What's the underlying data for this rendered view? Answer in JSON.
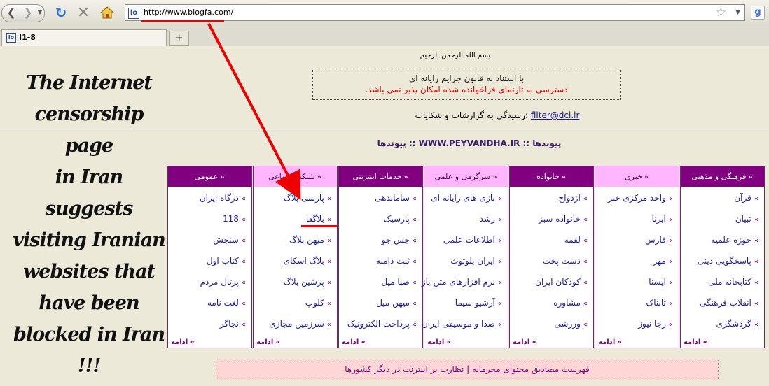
{
  "browser": {
    "url": "http://www.blogfa.com/",
    "tab_title": "I1-8",
    "favicon_letters": "lo",
    "new_tab_symbol": "+",
    "google_letter": "g"
  },
  "page": {
    "bismillah": "بسم الله الرحمن الرحیم",
    "notice_line1": "با استناد به قانون جرایم رایانه ای",
    "notice_line2": "دسترسی به تارنمای فراخوانده شده امکان پذیر نمی باشد.",
    "complaint_text": "رسیدگی به گزارشات و شکایات:",
    "complaint_email": "filter@dci.ir",
    "peyvandha": "پیوندها :: WWW.PEYVANDHA.IR :: پیوندها",
    "footer_link1": "فهرست مصادیق محتوای مجرمانه",
    "footer_sep": "|",
    "footer_link2": "نظارت بر اینترنت در دیگر کشورها"
  },
  "caption": {
    "lines": [
      "The Internet",
      "censorship page",
      "in Iran suggests",
      "visiting Iranian",
      "websites that",
      "have been",
      "blocked in Iran",
      "!!!"
    ]
  },
  "grid": {
    "more_label": "ادامه",
    "columns": [
      {
        "title": "عمومی",
        "style": "purple",
        "items": [
          "درگاه ایران",
          "118",
          "سنجش",
          "کتاب اول",
          "پرتال مردم",
          "لغت نامه",
          "نجاگر"
        ]
      },
      {
        "title": "شبکه اجتماعی",
        "style": "pink",
        "items": [
          "پارسی بلاگ",
          "بلاگفا",
          "میهن بلاگ",
          "بلاگ اسکای",
          "پرشین بلاگ",
          "کلوپ",
          "سرزمین مجازی"
        ]
      },
      {
        "title": "خدمات اینترنتی",
        "style": "purple",
        "items": [
          "ساماندهی",
          "پارسیک",
          "جس جو",
          "ثبت دامنه",
          "صبا میل",
          "میهن میل",
          "پرداخت الکترونیک"
        ]
      },
      {
        "title": "سرگرمی و علمی",
        "style": "pink",
        "items": [
          "بازی های رایانه ای",
          "رشد",
          "اطلاعات علمی",
          "ایران بلوتوث",
          "نرم افزارهای متن باز",
          "آرشیو سیما",
          "صدا و موسیقی ایران"
        ]
      },
      {
        "title": "خانواده",
        "style": "purple",
        "items": [
          "ازدواج",
          "خانواده سبز",
          "لقمه",
          "دست پخت",
          "کودکان ایران",
          "مشاوره",
          "ورزشی"
        ]
      },
      {
        "title": "خبری",
        "style": "pink",
        "items": [
          "واحد مرکزی خبر",
          "ایرنا",
          "فارس",
          "مهر",
          "ایسنا",
          "تابناک",
          "رجا نیوز"
        ]
      },
      {
        "title": "فرهنگی و مذهبی",
        "style": "purple",
        "items": [
          "قرآن",
          "تبیان",
          "حوزه علمیه",
          "پاسخگویی دینی",
          "کتابخانه ملی",
          "انقلاب فرهنگی",
          "گردشگری"
        ]
      }
    ]
  }
}
